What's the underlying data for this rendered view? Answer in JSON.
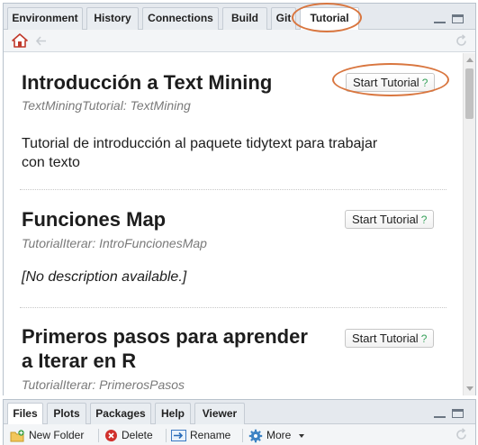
{
  "top_tabs": [
    {
      "label": "Environment"
    },
    {
      "label": "History"
    },
    {
      "label": "Connections"
    },
    {
      "label": "Build"
    },
    {
      "label": "Git"
    },
    {
      "label": "Tutorial"
    }
  ],
  "tutorials": [
    {
      "title_lines": [
        "Introducción a Text Mining"
      ],
      "package": "TextMiningTutorial: TextMining",
      "description_lines": [
        "Tutorial de introducción al paquete tidytext para trabajar",
        "con texto"
      ],
      "button": "Start Tutorial",
      "help": "?"
    },
    {
      "title_lines": [
        "Funciones Map"
      ],
      "package": "TutorialIterar: IntroFuncionesMap",
      "description_lines": [
        "[No description available.]"
      ],
      "button": "Start Tutorial",
      "help": "?"
    },
    {
      "title_lines": [
        "Primeros pasos para aprender",
        "a Iterar en R"
      ],
      "package": "TutorialIterar: PrimerosPasos",
      "description_lines": [],
      "button": "Start Tutorial",
      "help": "?"
    }
  ],
  "bottom_tabs": [
    {
      "label": "Files"
    },
    {
      "label": "Plots"
    },
    {
      "label": "Packages"
    },
    {
      "label": "Help"
    },
    {
      "label": "Viewer"
    }
  ],
  "files_toolbar": {
    "new_folder": "New Folder",
    "delete": "Delete",
    "rename": "Rename",
    "more": "More"
  },
  "colors": {
    "annotation": "#d9763f",
    "help_mark": "#3aa35d",
    "home_icon": "#c0392b"
  },
  "icons": [
    "home-icon",
    "back-icon",
    "refresh-icon",
    "minimize-icon",
    "maximize-icon",
    "new-folder-icon",
    "delete-icon",
    "rename-icon",
    "gear-icon",
    "dropdown-arrow-icon"
  ]
}
